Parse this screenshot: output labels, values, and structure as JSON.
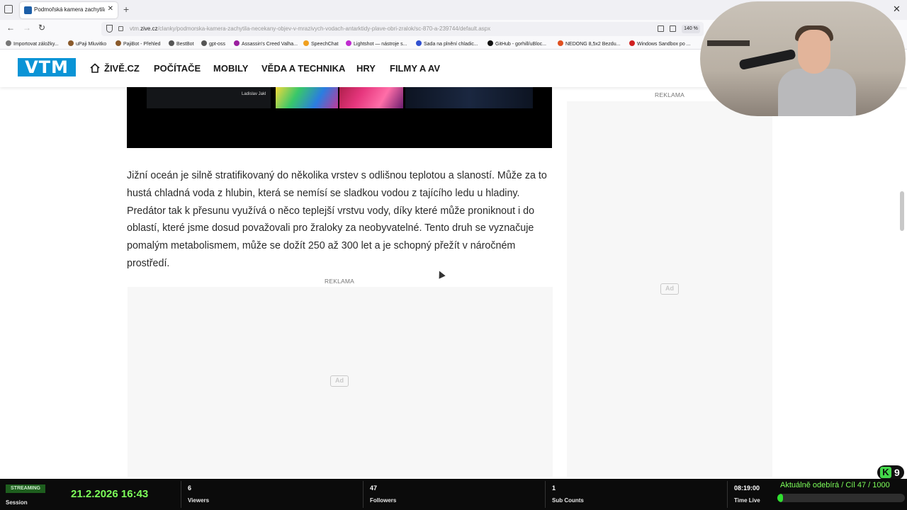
{
  "browser": {
    "tab_title": "Podmořská kamera zachytila ne",
    "url_host": "vtm.zive.cz",
    "url_path": "/clanky/podmorska-kamera-zachytila-necekany-objev-v-mrazivych-vodach-antarktidy-plave-obri-zralok/sc-870-a-239744/default.aspx",
    "url_prefix": "vtm.",
    "zoom": "140 %"
  },
  "bookmarks": [
    {
      "label": "Importovat záložky...",
      "color": "#777777"
    },
    {
      "label": "uPaji Mluvitko",
      "color": "#8a5a2b"
    },
    {
      "label": "PajiBot - Přehled",
      "color": "#8a5a2b"
    },
    {
      "label": "BestBot",
      "color": "#555555"
    },
    {
      "label": "gpt-oss",
      "color": "#555555"
    },
    {
      "label": "Assassin's Creed Valha...",
      "color": "#9b1fa0"
    },
    {
      "label": "SpeechChat",
      "color": "#f0a020"
    },
    {
      "label": "Lightshot — nástroje s...",
      "color": "#c02bd0"
    },
    {
      "label": "Sada na plnění chladic...",
      "color": "#3050d0"
    },
    {
      "label": "GitHub - gorhill/uBloc...",
      "color": "#111111"
    },
    {
      "label": "NEDONG 8,5x2 Bezdu...",
      "color": "#e05020"
    },
    {
      "label": "Windows Sandbox po ...",
      "color": "#d02020"
    }
  ],
  "site": {
    "logo": "VTM",
    "menu": [
      "ŽIVĚ.CZ",
      "POČÍTAČE",
      "MOBILY",
      "VĚDA A TECHNIKA",
      "HRY",
      "FILMY A AV"
    ]
  },
  "article": {
    "image_caption": "Ladislav Jakl",
    "paragraph": "Jižní oceán je silně stratifikovaný do několika vrstev s odlišnou teplotou a slaností. Může za to hustá chladná voda z hlubin, která se nemísí se sladkou vodou z tajícího ledu u hladiny. Predátor tak k přesunu využívá o něco teplejší vrstvu vody, díky které může proniknout i do oblastí, které jsme dosud považovali pro žraloky za neobyvatelné. Tento druh se vyznačuje pomalým metabolismem, může se dožít 250 až 300 let a je schopný přežít v náročném prostředí.",
    "ad_label": "REKLAMA",
    "ad_icon": "Ad"
  },
  "sidebar": {
    "ad_label": "REKLAMA",
    "ad_icon": "Ad"
  },
  "stream": {
    "badge": "STREAMING",
    "session_label": "Session",
    "datetime": "21.2.2026 16:43",
    "viewers_value": "6",
    "viewers_label": "Viewers",
    "followers_value": "47",
    "followers_label": "Followers",
    "subs_value": "1",
    "subs_label": "Sub Counts",
    "timelive_value": "08:19:00",
    "timelive_label": "Time Live",
    "goal_text": "Aktuálně odebírá / Cíl   47 / 1000",
    "goal_fraction": 0.047,
    "k_letter": "K",
    "k_number": "9",
    "accent": "#7dff5a"
  }
}
